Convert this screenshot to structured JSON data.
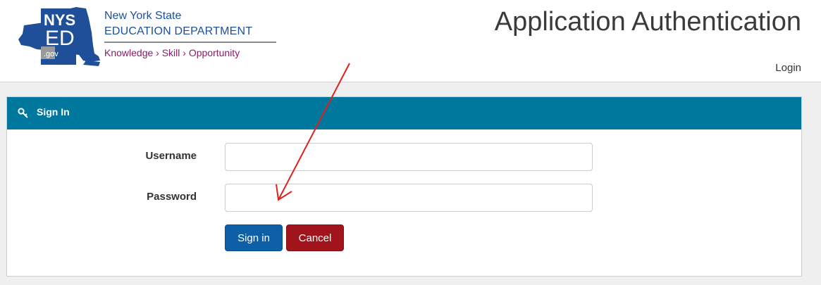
{
  "header": {
    "logo": {
      "mark_top": "NYS",
      "mark_mid": "ED",
      "mark_bottom": ".gov",
      "agency_line1": "New York State",
      "agency_line2": "EDUCATION DEPARTMENT",
      "tagline": "Knowledge › Skill › Opportunity"
    },
    "app_title": "Application Authentication",
    "app_subtitle": "Login"
  },
  "panel": {
    "title": "Sign In",
    "icon": "key-icon"
  },
  "form": {
    "username_label": "Username",
    "username_value": "",
    "password_label": "Password",
    "password_value": "",
    "signin_label": "Sign in",
    "cancel_label": "Cancel"
  },
  "colors": {
    "panel_heading": "#00789e",
    "primary_button": "#0d5fa6",
    "danger_button": "#a1141c",
    "agency_blue": "#1c4f9c",
    "tagline_purple": "#8c1a6a",
    "annotation_arrow": "#e0201a"
  }
}
